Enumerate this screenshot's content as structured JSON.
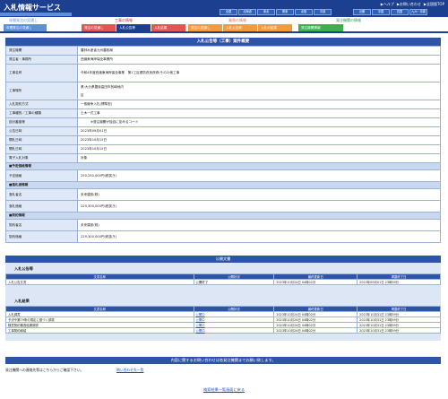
{
  "header": {
    "logo": "入札情報サービス",
    "toplinks": [
      "▶ヘルプ",
      "▶お問い合わせ",
      "▶全国版TOP"
    ],
    "regions_row1": [
      "全国",
      "北海道",
      "東北",
      "関東",
      "北陸",
      "中部",
      "近畿",
      "中国",
      "四国",
      "九州・沖縄"
    ]
  },
  "catnav": {
    "categories": [
      {
        "label": "年間発注の見通し",
        "color": "#5b8fd6"
      },
      {
        "label": "工事の情報",
        "color": "#d62828"
      },
      {
        "label": "業務の情報",
        "color": "#e47a1a"
      },
      {
        "label": "発注機関の情報",
        "color": "#2b9a3a"
      }
    ],
    "tabs": [
      {
        "label": "年間発注の見通し",
        "color": "#5b8fd6"
      },
      {
        "label": "発注の見通し",
        "color": "#e15555"
      },
      {
        "label": "入札公告等",
        "color": "#1d3f8f"
      },
      {
        "label": "入札結果",
        "color": "#e15555"
      },
      {
        "label": "発注の見通し",
        "color": "#f29b3e"
      },
      {
        "label": "入札公告等",
        "color": "#f29b3e"
      },
      {
        "label": "入札の結果",
        "color": "#f29b3e"
      },
      {
        "label": "発注機関情報",
        "color": "#3fae4c"
      }
    ]
  },
  "main": {
    "title": "入札公告等（工事）案件概要",
    "rows": [
      {
        "label": "発注機関",
        "value": "農林水産省九州農政局"
      },
      {
        "label": "発注者・事務所",
        "value": "西諸東海岸保全事業所"
      },
      {
        "label": "工事名称",
        "value": "令和4年度西諸東海岸保全事業　第1工区堤防改良改修(その2)他工事"
      },
      {
        "label": "工事場所",
        "value": "県:大分県豊後高田市呉崎地内",
        "value2": "区"
      },
      {
        "label": "入札契約方式",
        "value": "一般競争入札(標準型)"
      },
      {
        "label": "工事種別／工事の種類",
        "value": "土木一式工事"
      },
      {
        "label": "該計審査等",
        "value": "※発注機関が独自に定めるコード"
      },
      {
        "label": "公告日時",
        "value": "2023年09月01日"
      },
      {
        "label": "開札日時",
        "value": "2023年10月15日"
      },
      {
        "label": "開札日時",
        "value": "2023年10月15日"
      },
      {
        "label": "電子入札対象",
        "value": "対象"
      }
    ],
    "section_plan": "■予定価格情報",
    "plan_price_label": "予定価格",
    "plan_price": "250,250,000円(税抜き)",
    "section_winner": "■落札者情報",
    "winner_name_label": "落札者名",
    "winner_name": "未来建設(株)",
    "winner_price_label": "落札価格",
    "winner_price": "229,300,000円(税抜き)",
    "section_contract": "■契約情報",
    "contractor_label": "契約者名",
    "contractor": "未来建設(株)",
    "contract_price_label": "契約価格",
    "contract_price": "229,300,000円(税抜き)"
  },
  "documents": {
    "title": "公開文書",
    "notice_label": "入札公告等",
    "headers": [
      "文書名称",
      "公開状況",
      "最終更新日",
      "掲載終了日"
    ],
    "notice_rows": [
      [
        "入札公告文書",
        "公開終了",
        "2023年10月24日 04時02分",
        "2023年09月01日 23時59分"
      ]
    ],
    "result_label": "入札結果",
    "result_rows": [
      [
        "入札調書",
        "公開中",
        "2023年10月24日 04時02分",
        "2023年10月31日 23時59分"
      ],
      [
        "予決令第79条の規定に基づく調書",
        "公開中",
        "2023年10月24日 04時02分",
        "2023年10月31日 23時59分"
      ],
      [
        "随意契約審査結果調書",
        "公開中",
        "2023年10月24日 04時02分",
        "2023年10月31日 23時59分"
      ],
      [
        "工事契約締結",
        "公開中",
        "2023年10月24日 04時02分",
        "2023年10月31日 23時59分"
      ]
    ]
  },
  "footer": {
    "bar": "内容に関するお問い合わせは各発注機関までお願い致します。",
    "text": "発注機関への連絡先等はこちらからご確認下さい。",
    "link": "問い合わせ先一覧",
    "back": "検索結果一覧画面に戻る"
  }
}
